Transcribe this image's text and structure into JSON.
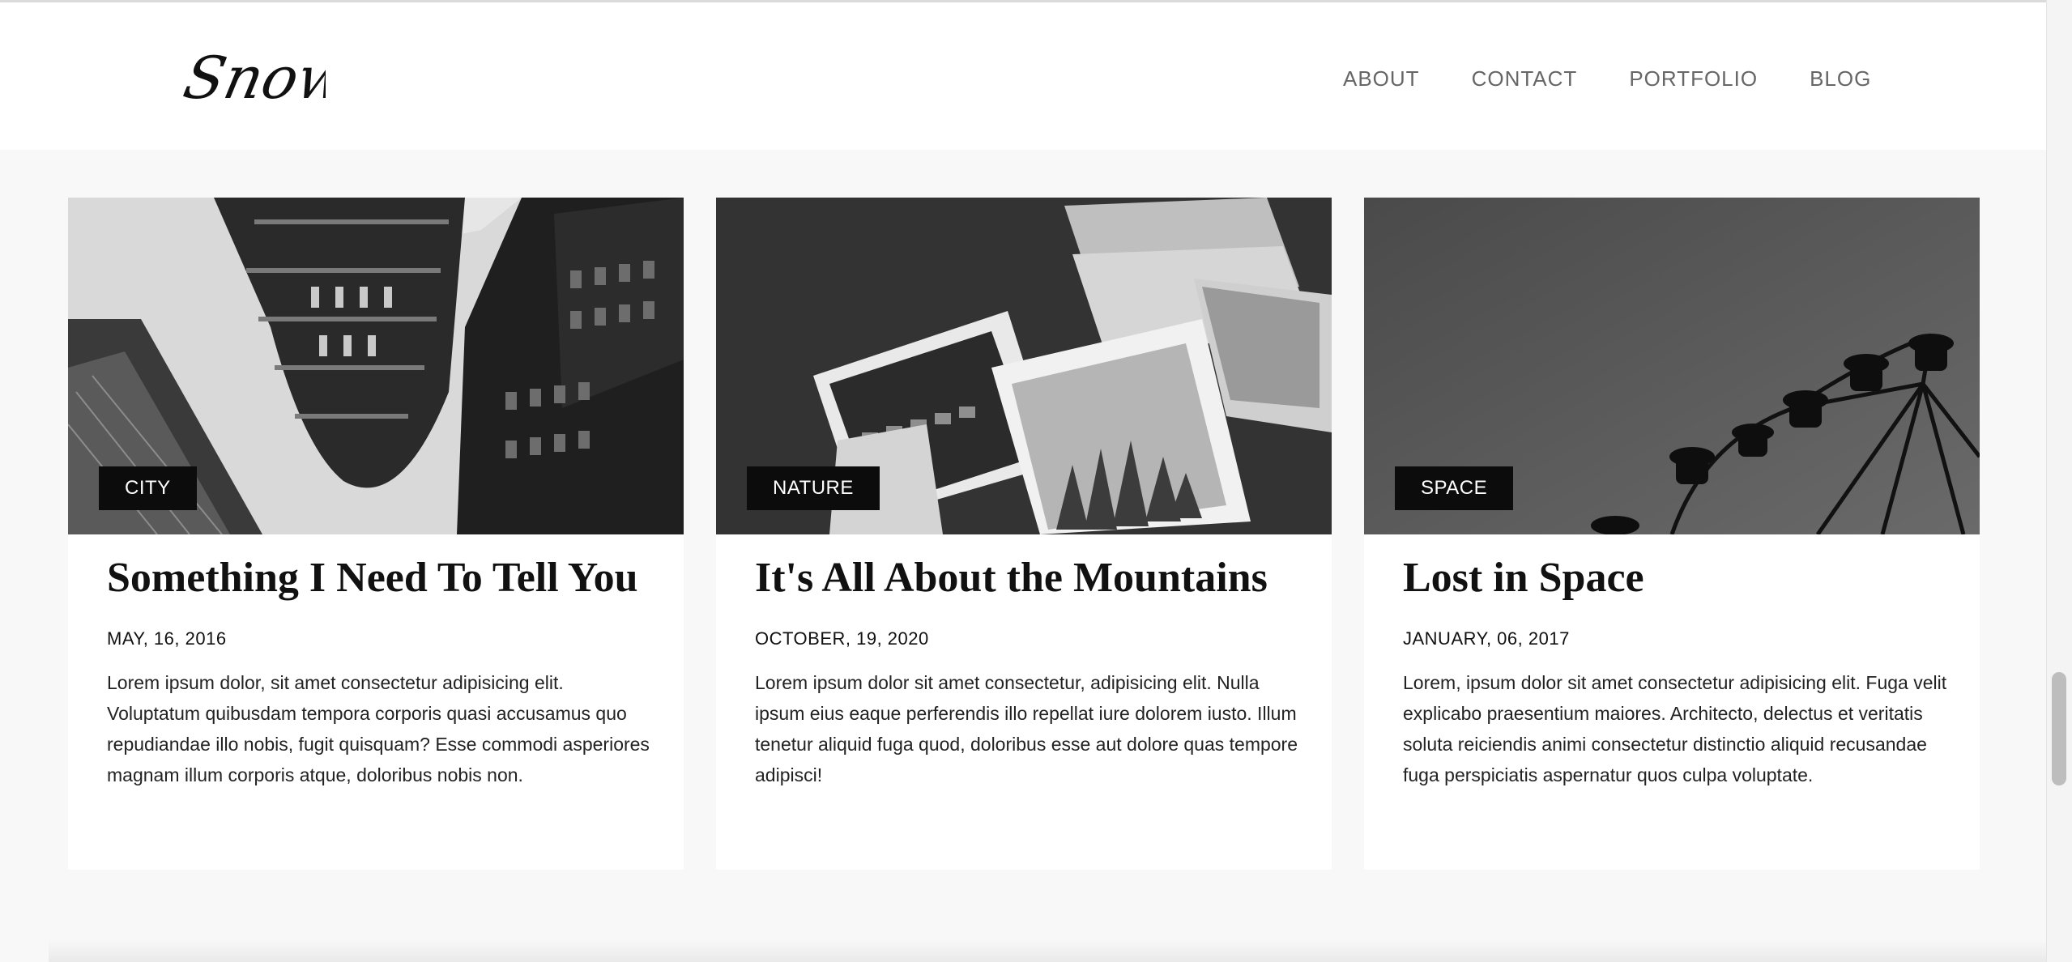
{
  "header": {
    "logo_text": "Snow",
    "nav": [
      {
        "label": "ABOUT"
      },
      {
        "label": "CONTACT"
      },
      {
        "label": "PORTFOLIO"
      },
      {
        "label": "BLOG"
      }
    ]
  },
  "posts": [
    {
      "category": "CITY",
      "title": "Something I Need To Tell You",
      "date": "MAY, 16, 2016",
      "excerpt": "Lorem ipsum dolor, sit amet consectetur adipisicing elit. Voluptatum quibusdam tempora corporis quasi accusamus quo repudiandae illo nobis, fugit quisquam? Esse commodi asperiores magnam illum corporis atque, doloribus nobis non.",
      "image": "city-buildings-photo"
    },
    {
      "category": "NATURE",
      "title": "It's All About the Mountains",
      "date": "OCTOBER, 19, 2020",
      "excerpt": "Lorem ipsum dolor sit amet consectetur, adipisicing elit. Nulla ipsum eius eaque perferendis illo repellat iure dolorem iusto. Illum tenetur aliquid fuga quod, doloribus esse aut dolore quas tempore adipisci!",
      "image": "scattered-photos-photo"
    },
    {
      "category": "SPACE",
      "title": "Lost in Space",
      "date": "JANUARY, 06, 2017",
      "excerpt": "Lorem, ipsum dolor sit amet consectetur adipisicing elit. Fuga velit explicabo praesentium maiores. Architecto, delectus et veritatis soluta reiciendis animi consectetur distinctio aliquid recusandae fuga perspiciatis aspernatur quos culpa voluptate.",
      "image": "ferris-wheel-photo"
    }
  ],
  "colors": {
    "page_background": "#f8f8f8",
    "card_background": "#ffffff",
    "tag_background": "#0c0c0c",
    "nav_text": "#666666"
  }
}
